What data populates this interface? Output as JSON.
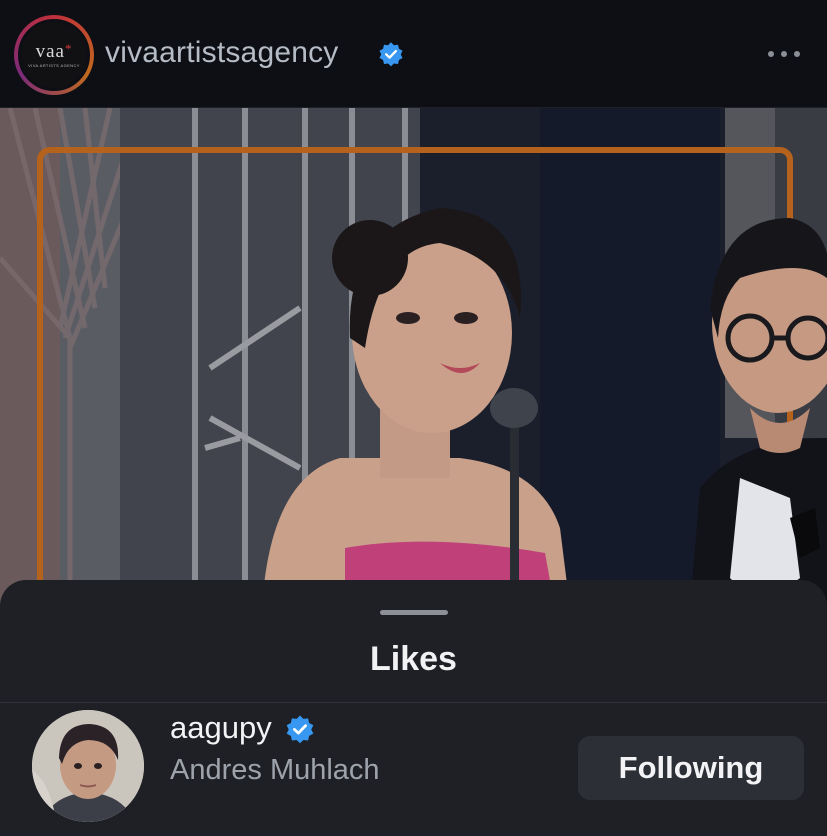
{
  "header": {
    "account_name": "vivaartistsagency",
    "logo": {
      "mark": "vaa",
      "subtitle": "VIVA ARTISTS AGENCY"
    },
    "verified_icon": "verified-badge-icon",
    "more_icon": "more-options-icon"
  },
  "post": {
    "image_icon": "photo"
  },
  "likes_sheet": {
    "title": "Likes",
    "users": [
      {
        "username": "aagupy",
        "full_name": "Andres Muhlach",
        "verified": true,
        "button_label": "Following"
      }
    ]
  },
  "colors": {
    "background": "#0d0f14",
    "sheet": "#1e2026",
    "verified_blue": "#3897f0",
    "button": "#2c2f36",
    "frame_orange": "#c06a1e"
  }
}
